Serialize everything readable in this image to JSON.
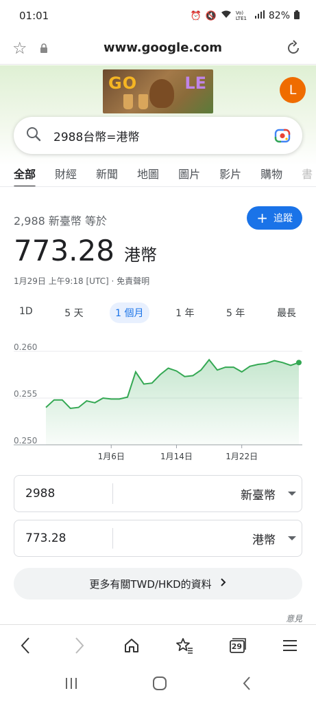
{
  "status_bar": {
    "time": "01:01",
    "battery": "82%",
    "lte_label": "Vo) LTE1"
  },
  "browser": {
    "url": "www.google.com"
  },
  "doodle": {
    "left_text": "GO",
    "right_text": "LE"
  },
  "account": {
    "avatar_letter": "L",
    "avatar_color": "#ef6c00"
  },
  "search": {
    "query": "2988台幣=港幣"
  },
  "tabs": [
    {
      "label": "全部",
      "active": true
    },
    {
      "label": "財經"
    },
    {
      "label": "新聞"
    },
    {
      "label": "地圖"
    },
    {
      "label": "圖片"
    },
    {
      "label": "影片"
    },
    {
      "label": "購物"
    },
    {
      "label": "書"
    }
  ],
  "result": {
    "subline": "2,988 新臺幣 等於",
    "value": "773.28",
    "currency": "港幣",
    "timestamp": "1月29日 上午9:18 [UTC] · 免責聲明",
    "follow_label": "追蹤"
  },
  "ranges": [
    {
      "label": "1D"
    },
    {
      "label": "5 天"
    },
    {
      "label": "1 個月",
      "active": true
    },
    {
      "label": "1 年"
    },
    {
      "label": "5 年"
    },
    {
      "label": "最長"
    }
  ],
  "chart_data": {
    "type": "area",
    "x_labels": [
      "1月6日",
      "1月14日",
      "1月22日"
    ],
    "y_ticks": [
      "0.260",
      "0.255",
      "0.250"
    ],
    "ylim": [
      0.25,
      0.26
    ],
    "values": [
      0.254,
      0.2548,
      0.2548,
      0.2539,
      0.254,
      0.2547,
      0.2545,
      0.255,
      0.2549,
      0.2549,
      0.2551,
      0.2578,
      0.2565,
      0.2566,
      0.2575,
      0.2582,
      0.2579,
      0.2573,
      0.2574,
      0.258,
      0.2591,
      0.258,
      0.2583,
      0.2583,
      0.2578,
      0.2584,
      0.2586,
      0.2587,
      0.259,
      0.2588,
      0.2585,
      0.2588
    ],
    "label_positions": [
      8,
      16,
      24
    ],
    "color": "#34a853"
  },
  "converter": {
    "from": {
      "amount": "2988",
      "currency": "新臺幣"
    },
    "to": {
      "amount": "773.28",
      "currency": "港幣"
    }
  },
  "more_button": {
    "label": "更多有關TWD/HKD的資料"
  },
  "feedback_label": "意見",
  "browser_bar": {
    "tab_count": "29"
  }
}
